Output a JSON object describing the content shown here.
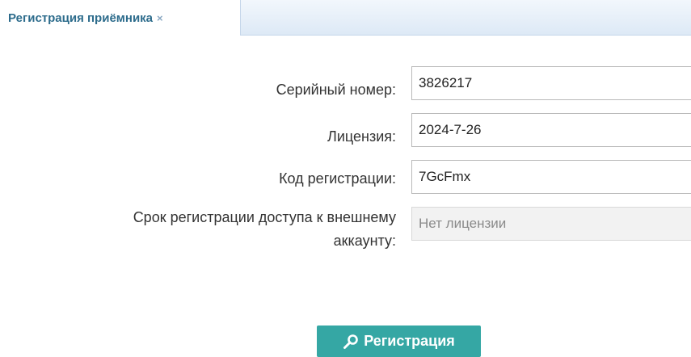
{
  "tab": {
    "title": "Регистрация приёмника",
    "close_glyph": "×"
  },
  "form": {
    "serial": {
      "label": "Серийный номер:",
      "value": "3826217"
    },
    "license": {
      "label": "Лицензия:",
      "value": "2024-7-26"
    },
    "reg_code": {
      "label": "Код регистрации:",
      "value": "7GcFmx"
    },
    "external_access": {
      "label_line1": "Срок регистрации доступа к внешнему",
      "label_line2": "аккаунту:",
      "value": "Нет лицензии"
    }
  },
  "button": {
    "label": "Регистрация",
    "icon": "key-icon",
    "color": "#35a7a4"
  }
}
